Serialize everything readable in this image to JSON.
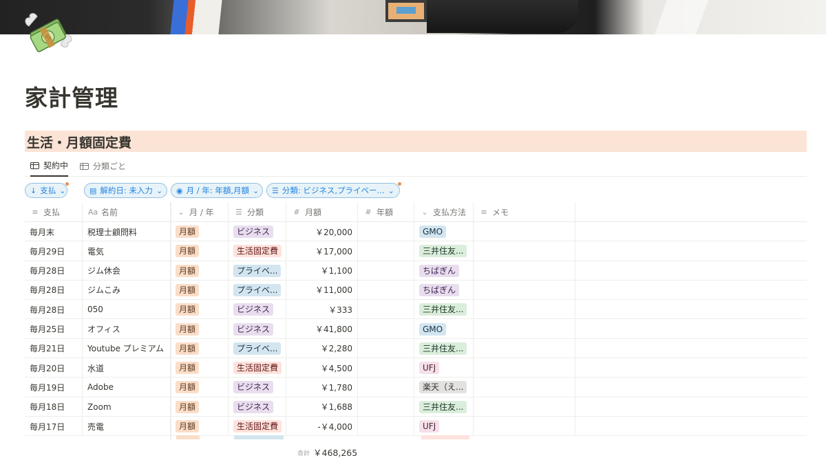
{
  "page": {
    "title": "家計管理"
  },
  "database": {
    "title": "生活・月額固定費",
    "views": [
      {
        "label": "契約中",
        "active": true
      },
      {
        "label": "分類ごと",
        "active": false
      }
    ],
    "filters": [
      {
        "icon": "arrow-down-icon",
        "label": "支払"
      },
      {
        "icon": "calendar-icon",
        "label": "解約日: 未入力"
      },
      {
        "icon": "select-icon",
        "label": "月 / 年: 年額,月額"
      },
      {
        "icon": "list-icon",
        "label": "分類: ビジネス,プライベー..."
      }
    ],
    "columns": [
      {
        "icon": "text-lines-icon",
        "glyph": "≡",
        "label": "支払"
      },
      {
        "icon": "title-icon",
        "glyph": "Aa",
        "label": "名前"
      },
      {
        "icon": "select-icon",
        "glyph": "⌄",
        "label": "月 / 年"
      },
      {
        "icon": "multi-select-icon",
        "glyph": "☰",
        "label": "分類"
      },
      {
        "icon": "number-icon",
        "glyph": "#",
        "label": "月額"
      },
      {
        "icon": "number-icon",
        "glyph": "#",
        "label": "年額"
      },
      {
        "icon": "select-icon",
        "glyph": "⌄",
        "label": "支払方法"
      },
      {
        "icon": "text-lines-icon",
        "glyph": "≡",
        "label": "メモ"
      }
    ],
    "rows": [
      {
        "pay": "毎月末",
        "name": "税理士顧問料",
        "period": "月額",
        "category": "ビジネス",
        "monthly": "￥20,000",
        "yearly": "",
        "method": "GMO",
        "memo": ""
      },
      {
        "pay": "毎月29日",
        "name": "電気",
        "period": "月額",
        "category": "生活固定費",
        "monthly": "￥17,000",
        "yearly": "",
        "method": "三井住友...",
        "memo": ""
      },
      {
        "pay": "毎月28日",
        "name": "ジム休会",
        "period": "月額",
        "category": "プライベ...",
        "monthly": "￥1,100",
        "yearly": "",
        "method": "ちばぎん",
        "memo": ""
      },
      {
        "pay": "毎月28日",
        "name": "ジムこみ",
        "period": "月額",
        "category": "プライベ...",
        "monthly": "￥11,000",
        "yearly": "",
        "method": "ちばぎん",
        "memo": ""
      },
      {
        "pay": "毎月28日",
        "name": "050",
        "period": "月額",
        "category": "ビジネス",
        "monthly": "￥333",
        "yearly": "",
        "method": "三井住友...",
        "memo": ""
      },
      {
        "pay": "毎月25日",
        "name": "オフィス",
        "period": "月額",
        "category": "ビジネス",
        "monthly": "￥41,800",
        "yearly": "",
        "method": "GMO",
        "memo": ""
      },
      {
        "pay": "毎月21日",
        "name": "Youtube プレミアム",
        "period": "月額",
        "category": "プライベ...",
        "monthly": "￥2,280",
        "yearly": "",
        "method": "三井住友...",
        "memo": ""
      },
      {
        "pay": "毎月20日",
        "name": "水道",
        "period": "月額",
        "category": "生活固定費",
        "monthly": "￥4,500",
        "yearly": "",
        "method": "UFJ",
        "memo": ""
      },
      {
        "pay": "毎月19日",
        "name": "Adobe",
        "period": "月額",
        "category": "ビジネス",
        "monthly": "￥1,780",
        "yearly": "",
        "method": "楽天（え...",
        "memo": ""
      },
      {
        "pay": "毎月18日",
        "name": "Zoom",
        "period": "月額",
        "category": "ビジネス",
        "monthly": "￥1,688",
        "yearly": "",
        "method": "三井住友...",
        "memo": ""
      },
      {
        "pay": "毎月17日",
        "name": "売電",
        "period": "月額",
        "category": "生活固定費",
        "monthly": "-￥4,000",
        "yearly": "",
        "method": "UFJ",
        "memo": ""
      }
    ],
    "footer": {
      "sum_label": "合計",
      "sum_value": "￥468,265"
    }
  },
  "tag_colors": {
    "月額": {
      "bg": "#fadec9",
      "fg": "#5f3a1f"
    },
    "ビジネス": {
      "bg": "#e8deee",
      "fg": "#412454"
    },
    "生活固定費": {
      "bg": "#ffe2dd",
      "fg": "#5d1715"
    },
    "プライベ...": {
      "bg": "#d3e5ef",
      "fg": "#183347"
    },
    "GMO": {
      "bg": "#d3e5ef",
      "fg": "#183347"
    },
    "三井住友...": {
      "bg": "#dbeddb",
      "fg": "#1c3829"
    },
    "ちばぎん": {
      "bg": "#e8deee",
      "fg": "#412454"
    },
    "UFJ": {
      "bg": "#f5e0e9",
      "fg": "#4c2337"
    },
    "楽天（え...": {
      "bg": "#e3e2e0",
      "fg": "#32302c"
    }
  }
}
